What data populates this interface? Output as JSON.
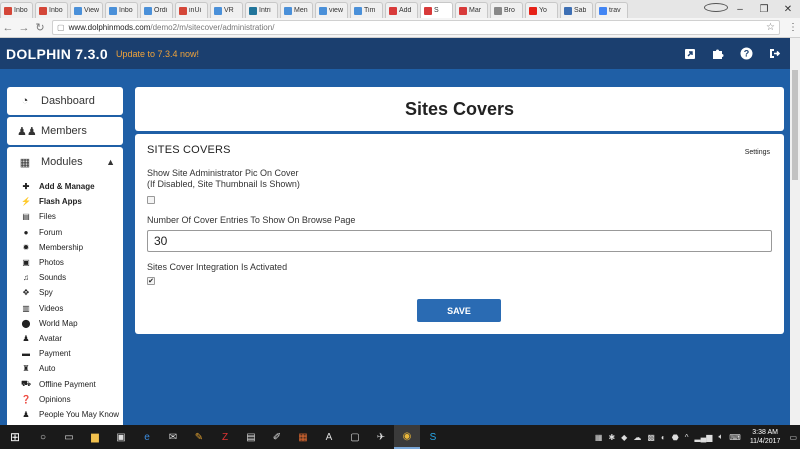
{
  "browser": {
    "tabs": [
      {
        "label": "Inbo",
        "icon": "gmail-icon",
        "color": "#d44638"
      },
      {
        "label": "Inbo",
        "icon": "gmail-icon",
        "color": "#d44638"
      },
      {
        "label": "View",
        "icon": "link-icon",
        "color": "#4a90d9"
      },
      {
        "label": "Inbo",
        "icon": "link-icon",
        "color": "#4a90d9"
      },
      {
        "label": "Ordi",
        "icon": "link-icon",
        "color": "#4a90d9"
      },
      {
        "label": "inUi",
        "icon": "page-icon",
        "color": "#d44638"
      },
      {
        "label": "VR",
        "icon": "link-icon",
        "color": "#4a90d9"
      },
      {
        "label": "Intri",
        "icon": "wordpress-icon",
        "color": "#21759b"
      },
      {
        "label": "Men",
        "icon": "link-icon",
        "color": "#4a90d9"
      },
      {
        "label": "view",
        "icon": "link-icon",
        "color": "#4a90d9"
      },
      {
        "label": "Tim",
        "icon": "link-icon",
        "color": "#4a90d9"
      },
      {
        "label": "Add",
        "icon": "dolphin-icon",
        "color": "#d83a3a"
      },
      {
        "label": "S",
        "icon": "dolphin-icon",
        "color": "#d83a3a",
        "active": true
      },
      {
        "label": "Mar",
        "icon": "dolphin-icon",
        "color": "#d83a3a"
      },
      {
        "label": "Bro",
        "icon": "page-icon",
        "color": "#888888"
      },
      {
        "label": "Yo",
        "icon": "youtube-icon",
        "color": "#e62117"
      },
      {
        "label": "Sab",
        "icon": "page-icon",
        "color": "#3d6fb4"
      },
      {
        "label": "trav",
        "icon": "google-icon",
        "color": "#4285f4"
      }
    ],
    "url_host": "www.dolphinmods.com",
    "url_path": "/demo2/m/sitecover/administration/"
  },
  "header": {
    "brand": "DOLPHIN 7.3.0",
    "update_link": "Update to 7.3.4 now!"
  },
  "sidebar": {
    "dashboard": "Dashboard",
    "members": "Members",
    "modules": "Modules",
    "items": [
      {
        "label": "Add & Manage",
        "icon": "plus-icon",
        "glyph": "✚",
        "bold": true
      },
      {
        "label": "Flash Apps",
        "icon": "lightning-icon",
        "glyph": "⚡",
        "bold": true
      },
      {
        "label": "Files",
        "icon": "file-icon",
        "glyph": "▤"
      },
      {
        "label": "Forum",
        "icon": "chat-icon",
        "glyph": "●"
      },
      {
        "label": "Membership",
        "icon": "gear-icon",
        "glyph": "✹"
      },
      {
        "label": "Photos",
        "icon": "photo-icon",
        "glyph": "▣"
      },
      {
        "label": "Sounds",
        "icon": "music-icon",
        "glyph": "♫"
      },
      {
        "label": "Spy",
        "icon": "crosshair-icon",
        "glyph": "✥"
      },
      {
        "label": "Videos",
        "icon": "film-icon",
        "glyph": "▥"
      },
      {
        "label": "World Map",
        "icon": "map-marker-icon",
        "glyph": "⬤"
      },
      {
        "label": "Avatar",
        "icon": "user-icon",
        "glyph": "♟"
      },
      {
        "label": "Payment",
        "icon": "credit-card-icon",
        "glyph": "▬"
      },
      {
        "label": "Auto",
        "icon": "car-icon",
        "glyph": "♜"
      },
      {
        "label": "Offline Payment",
        "icon": "cart-icon",
        "glyph": "⛟"
      },
      {
        "label": "Opinions",
        "icon": "question-icon",
        "glyph": "❓"
      },
      {
        "label": "People You May Know",
        "icon": "users-icon",
        "glyph": "♟"
      }
    ]
  },
  "main": {
    "title": "Sites Covers",
    "section_title": "SITES COVERS",
    "settings_link": "Settings",
    "field1_label_line1": "Show Site Administrator Pic On Cover",
    "field1_label_line2": "(If Disabled, Site Thumbnail Is Shown)",
    "field1_checked": false,
    "field2_label": "Number Of Cover Entries To Show On Browse Page",
    "field2_value": "30",
    "field3_label": "Sites Cover Integration Is Activated",
    "field3_checked": true,
    "save_label": "SAVE"
  },
  "taskbar": {
    "time": "3:38 AM",
    "date": "11/4/2017"
  },
  "colors": {
    "header_bg": "#1b3f6f",
    "page_bg": "#1f5fa6",
    "accent": "#2a6bb3",
    "update_text": "#f0a33a"
  }
}
